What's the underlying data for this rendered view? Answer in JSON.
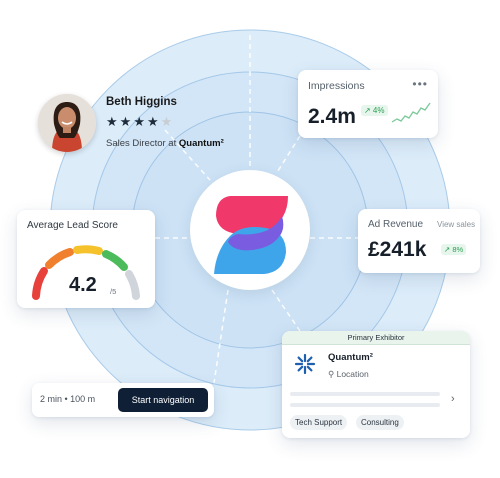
{
  "profile": {
    "name": "Beth Higgins",
    "rating": 4,
    "rating_max": 5,
    "title_prefix": "Sales Director at ",
    "company": "Quantum²"
  },
  "impressions": {
    "label": "Impressions",
    "value": "2.4m",
    "change": "↗ 4%"
  },
  "lead_score": {
    "label": "Average Lead Score",
    "value": "4.2",
    "unit": "/5"
  },
  "ad_revenue": {
    "label": "Ad Revenue",
    "link": "View sales",
    "value": "£241k",
    "change": "↗ 8%"
  },
  "navigation": {
    "info": "2 min • 100 m",
    "button": "Start navigation"
  },
  "exhibitor": {
    "header": "Primary Exhibitor",
    "name": "Quantum²",
    "location": "Location",
    "tags": [
      "Tech Support",
      "Consulting"
    ]
  },
  "colors": {
    "logo_pink": "#f0386b",
    "logo_purple": "#7a5ce0",
    "logo_blue": "#3fa5ea",
    "button_dark": "#0f1f35",
    "positive_green": "#2f9e55",
    "rings": "#a9cbe8",
    "bg_circle": "#d9eaf8"
  }
}
